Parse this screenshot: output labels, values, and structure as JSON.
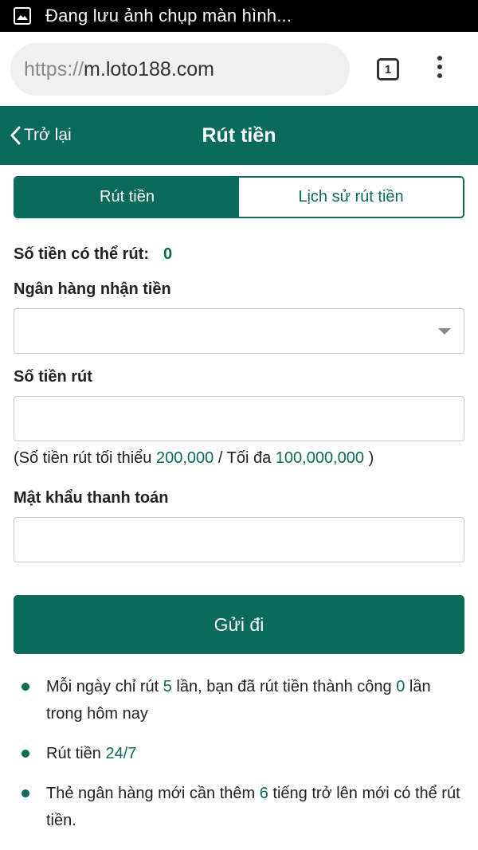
{
  "status_bar": {
    "text": "Đang lưu ảnh chụp màn hình..."
  },
  "browser": {
    "url_scheme": "https://",
    "url_host": "m.loto188.com",
    "tab_count": "1"
  },
  "header": {
    "back_label": "Trở lại",
    "title": "Rút tiền"
  },
  "tabs": [
    {
      "label": "Rút tiền",
      "active": true
    },
    {
      "label": "Lịch sử rút tiền",
      "active": false
    }
  ],
  "form": {
    "balance_label": "Số tiền có thể rút:",
    "balance_value": "0",
    "bank_label": "Ngân hàng nhận tiền",
    "bank_value": "",
    "amount_label": "Số tiền rút",
    "amount_value": "",
    "limit_prefix": "(Số tiền rút tối thiểu",
    "limit_min": "200,000",
    "limit_mid": "/ Tối đa",
    "limit_max": "100,000,000",
    "limit_suffix": ")",
    "password_label": "Mật khẩu thanh toán",
    "password_value": "",
    "submit_label": "Gửi đi"
  },
  "notes": [
    {
      "pre": "Mỗi ngày chỉ rút",
      "n1": "5",
      "mid": "lần, bạn đã rút tiền thành công",
      "n2": "0",
      "post": "lần trong hôm nay"
    },
    {
      "pre": "Rút tiền",
      "n1": "24/7"
    },
    {
      "pre": "Thẻ ngân hàng mới cần thêm",
      "n1": "6",
      "post": "tiếng trở lên mới có thể rút tiền."
    }
  ],
  "colors": {
    "accent": "#0b6b5a",
    "status_bar": "#000000"
  }
}
